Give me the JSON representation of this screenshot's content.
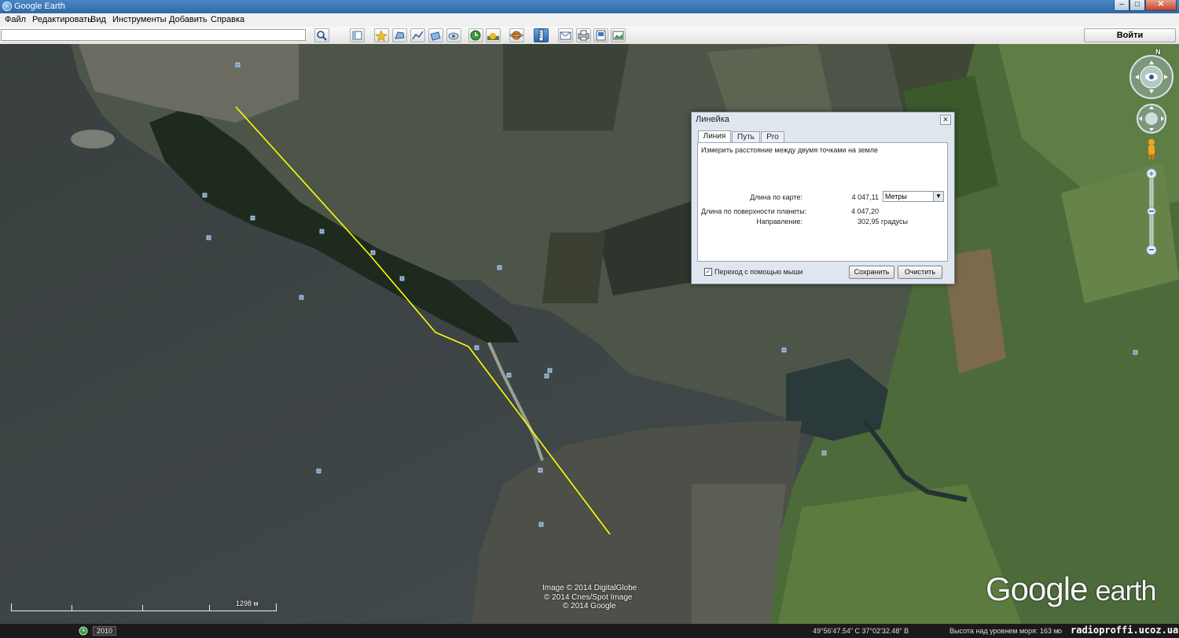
{
  "window": {
    "title": "Google Earth"
  },
  "menu": [
    "Файл",
    "Редактировать",
    "Вид",
    "Инструменты",
    "Добавить",
    "Справка"
  ],
  "toolbar": {
    "search_value": "",
    "login_label": "Войти",
    "icons": [
      "search-icon",
      "sidebar-icon",
      "placemark-icon",
      "polygon-icon",
      "path-icon",
      "overlay-icon",
      "tour-icon",
      "historical-imagery-icon",
      "sunlight-icon",
      "sky-icon",
      "ruler-icon",
      "email-icon",
      "print-icon",
      "map-view-icon",
      "image-icon"
    ]
  },
  "ruler": {
    "title": "Линейка",
    "tabs": [
      "Линия",
      "Путь",
      "Pro"
    ],
    "active_tab": "Линия",
    "description": "Измерить расстояние между двумя точками на земле",
    "map_length_label": "Длина по карте:",
    "map_length_value": "4 047,11",
    "unit": "Метры",
    "ground_length_label": "Длина по поверхности планеты:",
    "ground_length_value": "4 047,20",
    "heading_label": "Направление:",
    "heading_value": "302,95 градусы",
    "mouse_nav_label": "Переход с помощью мыши",
    "mouse_nav_checked": true,
    "save_label": "Сохранить",
    "clear_label": "Очистить"
  },
  "map": {
    "attribution": [
      "Image © 2014 DigitalGlobe",
      "© 2014 Cnes/Spot Image",
      "© 2014 Google"
    ],
    "logo_google": "Google",
    "logo_earth": "earth",
    "scale_label": "1298 м",
    "compass_north": "N",
    "measure_line_color": "#ffff00"
  },
  "status": {
    "year": "2010",
    "coordinates": "49°56'47.54\" С   37°02'32.48\" В",
    "elevation": "Высота над уровнем моря:   163 м",
    "eye_alt_prefix": "о",
    "watermark": "radioproffi.ucoz.ua"
  }
}
